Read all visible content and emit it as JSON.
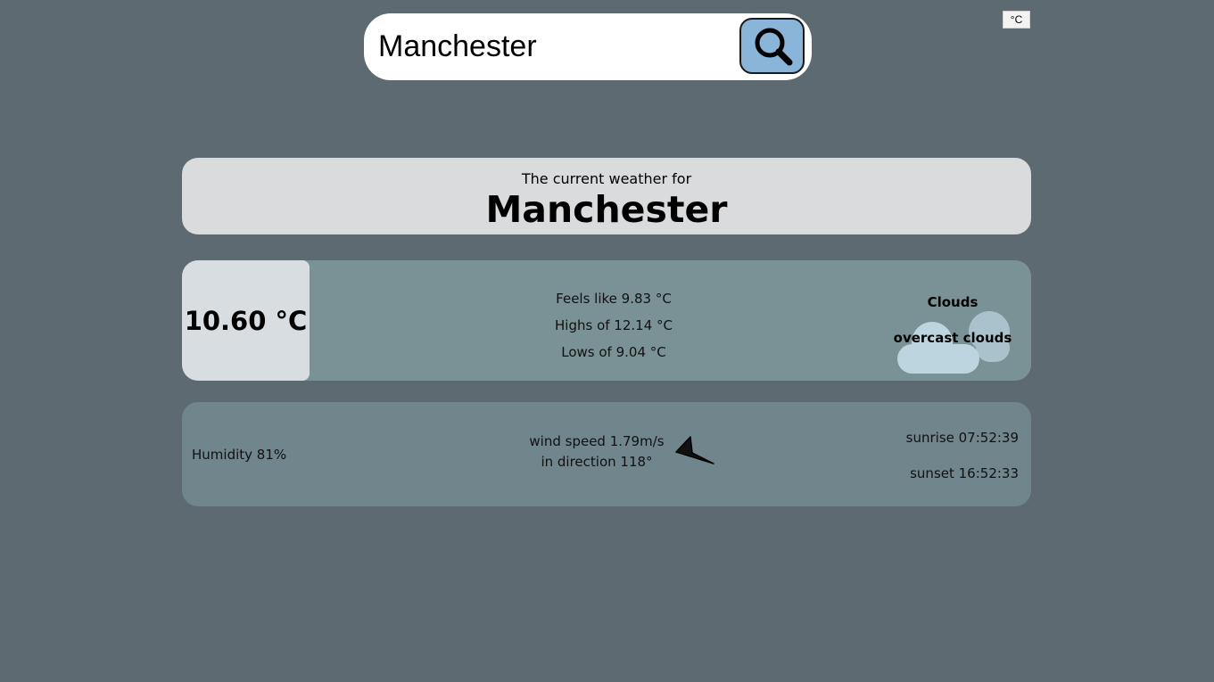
{
  "search": {
    "value": "Manchester"
  },
  "unit_toggle": {
    "label": "°C"
  },
  "location": {
    "subtitle": "The current weather for",
    "city": "Manchester"
  },
  "current": {
    "temperature": "10.60 °C",
    "feels_like": "Feels like 9.83 °C",
    "high": "Highs of 12.14 °C",
    "low": "Lows of 9.04 °C",
    "condition": "Clouds",
    "description": "overcast clouds",
    "condition_icon": "cloud-icon"
  },
  "details": {
    "humidity": "Humidity 81%",
    "wind_speed": "wind speed 1.79m/s",
    "wind_direction_text": "in direction 118°",
    "wind_direction_deg": 118,
    "sunrise": "sunrise 07:52:39",
    "sunset": "sunset 16:52:33"
  },
  "icons": {
    "search": "search-icon",
    "wind": "wind-direction-arrow-icon"
  },
  "colors": {
    "background": "#5e6a71",
    "search_button": "#8ab4d8",
    "title_card": "#d9dbdd",
    "temp_card": "#7a9196",
    "temp_main": "#d7dde0",
    "info_card": "#70858c"
  }
}
